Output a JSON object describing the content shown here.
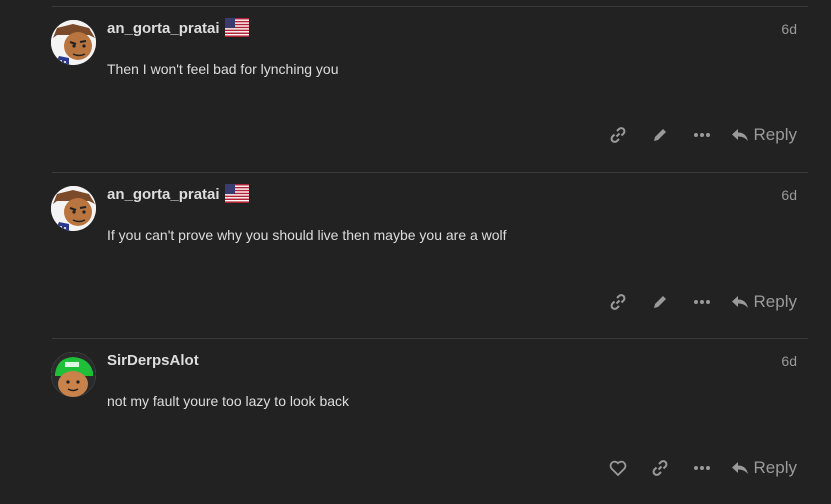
{
  "posts": [
    {
      "username": "an_gorta_pratai",
      "flag_icon": "us-flag-icon",
      "age": "6d",
      "text": "Then I won't feel bad for lynching you",
      "actions": [
        "link-icon",
        "edit-icon",
        "more-icon"
      ],
      "reply_label": "Reply"
    },
    {
      "username": "an_gorta_pratai",
      "flag_icon": "us-flag-icon",
      "age": "6d",
      "text": "If you can't prove why you should live then maybe you are a wolf",
      "actions": [
        "link-icon",
        "edit-icon",
        "more-icon"
      ],
      "reply_label": "Reply"
    },
    {
      "username": "SirDerpsAlot",
      "age": "6d",
      "text": "not my fault youre too lazy to look back",
      "actions": [
        "heart-icon",
        "link-icon",
        "more-icon"
      ],
      "reply_label": "Reply"
    }
  ],
  "colors": {
    "background": "#222222",
    "text": "#dddddd",
    "muted": "#9a9a9a",
    "divider": "#3a3a3a"
  }
}
